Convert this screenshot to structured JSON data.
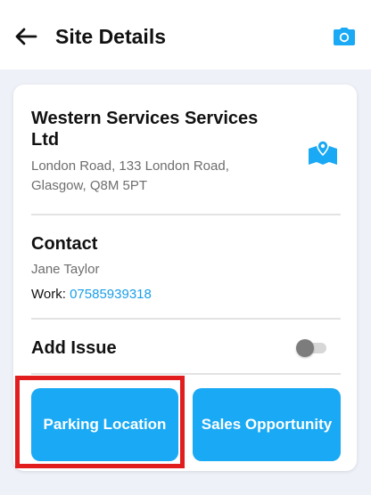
{
  "header": {
    "title": "Site Details",
    "back_icon": "arrow-left-icon",
    "camera_icon": "camera-icon"
  },
  "site": {
    "company_name": "Western Services Services Ltd",
    "address": "London Road, 133 London Road, Glasgow, Q8M 5PT",
    "map_icon": "map-pin-icon"
  },
  "contact": {
    "heading": "Contact",
    "name": "Jane Taylor",
    "work_label": "Work:",
    "work_phone": "07585939318"
  },
  "issue": {
    "label": "Add Issue",
    "toggle_on": false
  },
  "actions": {
    "parking_label": "Parking Location",
    "sales_label": "Sales Opportunity"
  },
  "colors": {
    "accent": "#1aa9f4",
    "link": "#1a9ee8",
    "highlight": "#e21d1d",
    "page_background": "#eef1f8"
  }
}
